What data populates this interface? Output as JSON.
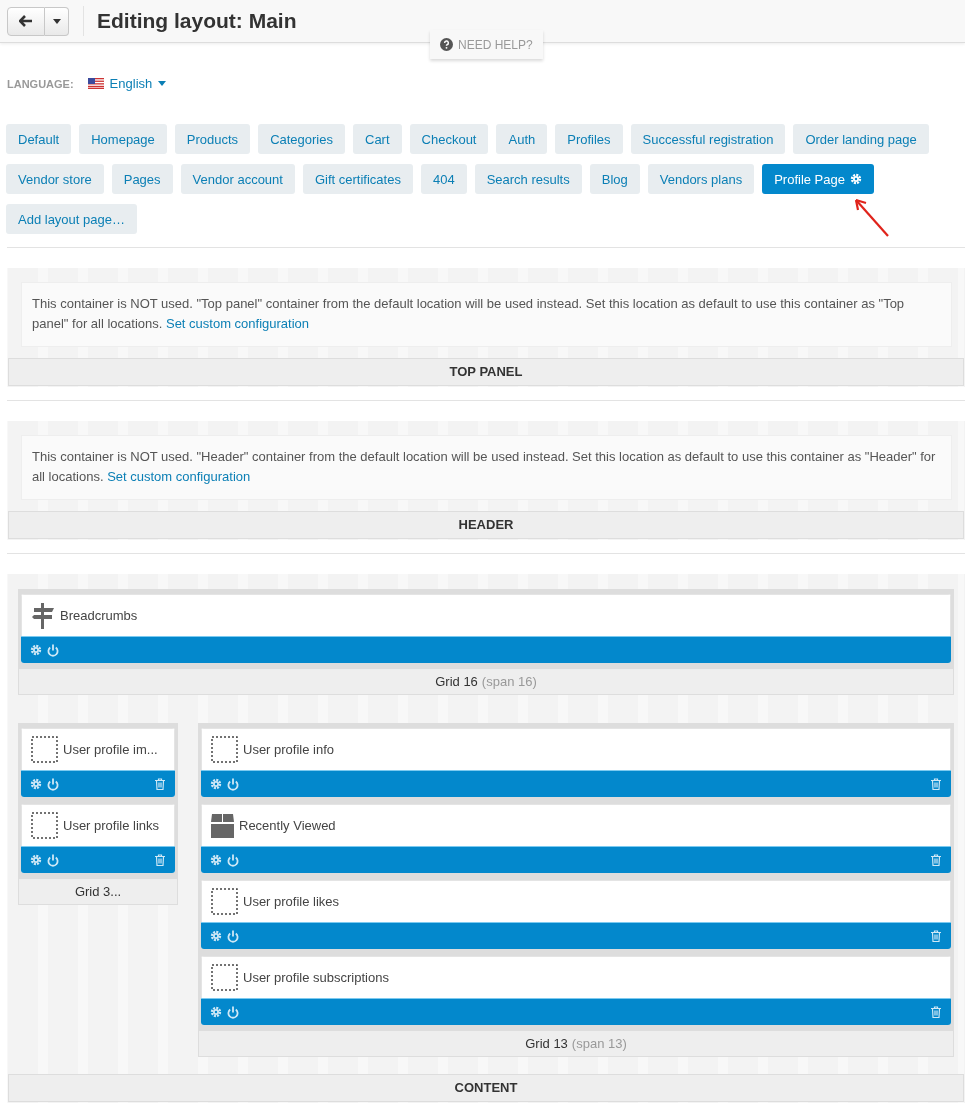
{
  "header": {
    "title": "Editing layout: Main",
    "help": "NEED HELP?"
  },
  "language": {
    "label": "LANGUAGE:",
    "value": "English"
  },
  "tabs": [
    {
      "label": "Default",
      "selected": false
    },
    {
      "label": "Homepage",
      "selected": false
    },
    {
      "label": "Products",
      "selected": false
    },
    {
      "label": "Categories",
      "selected": false
    },
    {
      "label": "Cart",
      "selected": false
    },
    {
      "label": "Checkout",
      "selected": false
    },
    {
      "label": "Auth",
      "selected": false
    },
    {
      "label": "Profiles",
      "selected": false
    },
    {
      "label": "Successful registration",
      "selected": false
    },
    {
      "label": "Order landing page",
      "selected": false
    },
    {
      "label": "Vendor store",
      "selected": false
    },
    {
      "label": "Pages",
      "selected": false
    },
    {
      "label": "Vendor account",
      "selected": false
    },
    {
      "label": "Gift certificates",
      "selected": false
    },
    {
      "label": "404",
      "selected": false
    },
    {
      "label": "Search results",
      "selected": false
    },
    {
      "label": "Blog",
      "selected": false
    },
    {
      "label": "Vendors plans",
      "selected": false
    },
    {
      "label": "Profile Page",
      "selected": true
    }
  ],
  "add_tab": "Add layout page…",
  "notice_containers": [
    {
      "message": "This container is NOT used. \"Top panel\" container from the default location will be used instead. Set this location as default to use this container as \"Top panel\" for all locations.",
      "link": "Set custom configuration",
      "label": "TOP PANEL"
    },
    {
      "message": "This container is NOT used. \"Header\" container from the default location will be used instead. Set this location as default to use this container as \"Header\" for all locations.",
      "link": "Set custom configuration",
      "label": "HEADER"
    }
  ],
  "content": {
    "label": "CONTENT",
    "rows": [
      [
        {
          "title": "Grid 16",
          "span": "(span 16)",
          "blocks": [
            {
              "name": "Breadcrumbs",
              "kind": "signpost",
              "removable": false
            }
          ]
        }
      ],
      [
        {
          "title": "Grid 3...",
          "blocks": [
            {
              "name": "User profile im...",
              "kind": "dotted",
              "removable": true
            },
            {
              "name": "User profile links",
              "kind": "dotted",
              "removable": true
            }
          ]
        },
        {
          "title": "Grid 13",
          "span": "(span 13)",
          "blocks": [
            {
              "name": "User profile info",
              "kind": "dotted",
              "removable": true
            },
            {
              "name": "Recently Viewed",
              "kind": "box",
              "removable": true
            },
            {
              "name": "User profile likes",
              "kind": "dotted",
              "removable": true
            },
            {
              "name": "User profile subscriptions",
              "kind": "dotted",
              "removable": true
            }
          ]
        }
      ]
    ]
  }
}
